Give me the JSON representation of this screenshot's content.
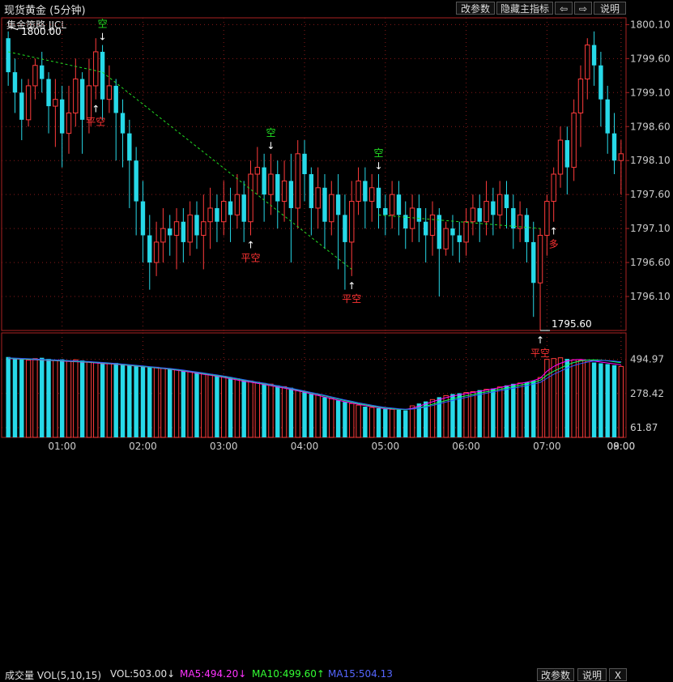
{
  "window": {
    "title": "现货黄金 (5分钟)",
    "strategy_label": "集金策略 JJCL",
    "buttons": [
      "改参数",
      "隐藏主指标",
      "⇦",
      "⇨",
      "说明"
    ]
  },
  "volume_panel": {
    "title": "成交量 VOL(5,10,15)",
    "vol": "VOL:503.00↓",
    "ma5": "MA5:494.20↓",
    "ma10": "MA10:499.60↑",
    "ma15": "MA15:504.13",
    "buttons": [
      "改参数",
      "说明",
      "X"
    ]
  },
  "colors": {
    "up": "#ff3b3b",
    "down": "#27d9e8",
    "up_vol": "#ff3b3b",
    "down_vol": "#27d9e8",
    "grid": "#8a1a1a",
    "axis_text": "#cccccc",
    "ma5": "#ff00ff",
    "ma10": "#00ff66",
    "ma15": "#3355ff",
    "signal_green": "#22dd22",
    "signal_red": "#ff3333",
    "trendline": "#22dd22",
    "ma5_text": "#ff33ff",
    "ma10_text": "#33ff33",
    "ma15_text": "#5566ff"
  },
  "chart_data": [
    {
      "type": "candlestick",
      "price_axis_ticks": [
        "1800.10",
        "1799.60",
        "1799.10",
        "1798.60",
        "1798.10",
        "1797.60",
        "1797.10",
        "1796.60",
        "1796.10"
      ],
      "ylim": [
        1795.6,
        1800.2
      ],
      "time_ticks": [
        "01:00",
        "02:00",
        "03:00",
        "04:00",
        "05:00",
        "06:00",
        "07:00",
        "08:00",
        "09:00"
      ],
      "annotations": [
        {
          "text": "1800.00",
          "price": 1800.0
        },
        {
          "text": "1795.60",
          "price": 1795.6
        }
      ],
      "signals": [
        {
          "label": "空",
          "kind": "short",
          "bar": 14
        },
        {
          "label": "平空",
          "kind": "cover",
          "bar": 13
        },
        {
          "label": "平空",
          "kind": "cover",
          "bar": 36
        },
        {
          "label": "空",
          "kind": "short",
          "bar": 39
        },
        {
          "label": "平空",
          "kind": "cover",
          "bar": 51
        },
        {
          "label": "空",
          "kind": "short",
          "bar": 55
        },
        {
          "label": "平空",
          "kind": "cover",
          "bar": 79
        },
        {
          "label": "多",
          "kind": "long",
          "bar": 81
        }
      ],
      "candles": [
        [
          1799.9,
          1799.4,
          1800.0,
          1799.2
        ],
        [
          1799.4,
          1799.1,
          1799.6,
          1798.8
        ],
        [
          1799.1,
          1798.7,
          1799.3,
          1798.4
        ],
        [
          1798.7,
          1799.2,
          1799.3,
          1798.6
        ],
        [
          1799.2,
          1799.5,
          1799.6,
          1799.0
        ],
        [
          1799.5,
          1799.3,
          1799.7,
          1799.1
        ],
        [
          1799.3,
          1798.9,
          1799.4,
          1798.5
        ],
        [
          1798.9,
          1799.0,
          1799.3,
          1798.3
        ],
        [
          1799.0,
          1798.5,
          1799.2,
          1798.0
        ],
        [
          1798.5,
          1798.8,
          1799.2,
          1798.2
        ],
        [
          1798.8,
          1799.3,
          1799.6,
          1798.6
        ],
        [
          1799.3,
          1798.7,
          1799.4,
          1798.2
        ],
        [
          1798.7,
          1799.2,
          1799.6,
          1798.5
        ],
        [
          1799.2,
          1799.7,
          1799.9,
          1799.0
        ],
        [
          1799.7,
          1799.0,
          1799.8,
          1798.7
        ],
        [
          1799.0,
          1799.2,
          1799.5,
          1798.8
        ],
        [
          1799.2,
          1798.8,
          1799.3,
          1798.1
        ],
        [
          1798.8,
          1798.5,
          1799.0,
          1798.0
        ],
        [
          1798.5,
          1798.1,
          1798.7,
          1797.4
        ],
        [
          1798.1,
          1797.5,
          1798.3,
          1797.0
        ],
        [
          1797.5,
          1797.0,
          1797.8,
          1796.6
        ],
        [
          1797.0,
          1796.6,
          1797.3,
          1796.2
        ],
        [
          1796.6,
          1796.9,
          1797.2,
          1796.4
        ],
        [
          1796.9,
          1797.1,
          1797.4,
          1796.6
        ],
        [
          1797.1,
          1797.0,
          1797.3,
          1796.7
        ],
        [
          1797.0,
          1797.2,
          1797.4,
          1796.5
        ],
        [
          1797.2,
          1796.9,
          1797.4,
          1796.6
        ],
        [
          1796.9,
          1797.3,
          1797.5,
          1796.7
        ],
        [
          1797.3,
          1797.0,
          1797.5,
          1796.8
        ],
        [
          1797.0,
          1797.2,
          1797.6,
          1796.5
        ],
        [
          1797.2,
          1797.4,
          1797.7,
          1796.8
        ],
        [
          1797.4,
          1797.2,
          1797.6,
          1796.9
        ],
        [
          1797.2,
          1797.5,
          1797.8,
          1797.0
        ],
        [
          1797.5,
          1797.3,
          1797.7,
          1796.9
        ],
        [
          1797.3,
          1797.6,
          1797.9,
          1797.1
        ],
        [
          1797.6,
          1797.2,
          1797.8,
          1796.9
        ],
        [
          1797.2,
          1797.9,
          1798.1,
          1797.0
        ],
        [
          1797.9,
          1798.0,
          1798.3,
          1797.6
        ],
        [
          1798.0,
          1797.6,
          1798.2,
          1797.2
        ],
        [
          1797.6,
          1797.9,
          1798.2,
          1797.3
        ],
        [
          1797.9,
          1797.5,
          1798.1,
          1797.1
        ],
        [
          1797.5,
          1797.8,
          1798.1,
          1797.2
        ],
        [
          1797.8,
          1797.4,
          1798.2,
          1796.6
        ],
        [
          1797.4,
          1798.2,
          1798.4,
          1797.1
        ],
        [
          1798.2,
          1797.9,
          1798.4,
          1797.5
        ],
        [
          1797.9,
          1797.4,
          1798.0,
          1797.0
        ],
        [
          1797.4,
          1797.7,
          1798.0,
          1797.1
        ],
        [
          1797.7,
          1797.2,
          1797.9,
          1796.8
        ],
        [
          1797.2,
          1797.6,
          1797.8,
          1797.0
        ],
        [
          1797.6,
          1797.3,
          1797.9,
          1796.5
        ],
        [
          1797.3,
          1796.9,
          1797.6,
          1796.2
        ],
        [
          1796.9,
          1797.5,
          1797.8,
          1796.4
        ],
        [
          1797.5,
          1797.8,
          1798.0,
          1797.3
        ],
        [
          1797.8,
          1797.5,
          1798.0,
          1797.1
        ],
        [
          1797.5,
          1797.7,
          1797.9,
          1797.2
        ],
        [
          1797.7,
          1797.4,
          1797.9,
          1797.1
        ],
        [
          1797.4,
          1797.3,
          1797.6,
          1797.0
        ],
        [
          1797.3,
          1797.6,
          1797.8,
          1797.1
        ],
        [
          1797.6,
          1797.3,
          1797.8,
          1797.0
        ],
        [
          1797.3,
          1797.1,
          1797.5,
          1796.8
        ],
        [
          1797.1,
          1797.4,
          1797.6,
          1796.9
        ],
        [
          1797.4,
          1797.2,
          1797.6,
          1796.9
        ],
        [
          1797.2,
          1797.0,
          1797.4,
          1796.6
        ],
        [
          1797.0,
          1797.3,
          1797.5,
          1796.7
        ],
        [
          1797.3,
          1796.8,
          1797.4,
          1796.1
        ],
        [
          1796.8,
          1797.1,
          1797.2,
          1796.7
        ],
        [
          1797.1,
          1797.0,
          1797.3,
          1796.7
        ],
        [
          1797.0,
          1796.9,
          1797.2,
          1796.6
        ],
        [
          1796.9,
          1797.2,
          1797.4,
          1796.7
        ],
        [
          1797.2,
          1797.4,
          1797.6,
          1797.0
        ],
        [
          1797.4,
          1797.2,
          1797.6,
          1796.9
        ],
        [
          1797.2,
          1797.5,
          1797.8,
          1797.0
        ],
        [
          1797.5,
          1797.3,
          1797.7,
          1797.0
        ],
        [
          1797.3,
          1797.6,
          1797.8,
          1797.1
        ],
        [
          1797.6,
          1797.4,
          1797.8,
          1797.1
        ],
        [
          1797.4,
          1797.1,
          1797.6,
          1796.8
        ],
        [
          1797.1,
          1797.3,
          1797.5,
          1796.9
        ],
        [
          1797.3,
          1796.9,
          1797.4,
          1796.6
        ],
        [
          1796.9,
          1796.3,
          1797.2,
          1795.8
        ],
        [
          1796.3,
          1797.0,
          1797.1,
          1795.6
        ],
        [
          1797.0,
          1797.5,
          1797.6,
          1796.7
        ],
        [
          1797.5,
          1797.9,
          1798.0,
          1797.2
        ],
        [
          1797.9,
          1798.4,
          1798.6,
          1797.7
        ],
        [
          1798.4,
          1798.0,
          1798.6,
          1797.6
        ],
        [
          1798.0,
          1798.8,
          1799.0,
          1797.8
        ],
        [
          1798.8,
          1799.3,
          1799.5,
          1798.3
        ],
        [
          1799.3,
          1799.8,
          1799.9,
          1799.0
        ],
        [
          1799.8,
          1799.5,
          1800.0,
          1799.2
        ],
        [
          1799.5,
          1799.0,
          1799.7,
          1798.6
        ],
        [
          1799.0,
          1798.5,
          1799.2,
          1798.2
        ],
        [
          1798.5,
          1798.1,
          1798.8,
          1797.9
        ],
        [
          1798.1,
          1798.2,
          1798.4,
          1797.6
        ]
      ],
      "trendlines": [
        {
          "from": {
            "bar": 0,
            "price": 1799.7
          },
          "to": {
            "bar": 14,
            "price": 1799.4
          }
        },
        {
          "from": {
            "bar": 14,
            "price": 1799.4
          },
          "to": {
            "bar": 51,
            "price": 1796.5
          }
        },
        {
          "from": {
            "bar": 55,
            "price": 1797.3
          },
          "to": {
            "bar": 79,
            "price": 1797.1
          }
        }
      ]
    },
    {
      "type": "bar",
      "name": "成交量",
      "vol_axis_ticks": [
        "494.97",
        "278.42",
        "61.87"
      ],
      "ylim": [
        0,
        560
      ],
      "volumes": [
        510,
        500,
        495,
        490,
        500,
        505,
        498,
        490,
        495,
        485,
        492,
        488,
        480,
        476,
        470,
        468,
        472,
        466,
        460,
        455,
        450,
        448,
        445,
        440,
        435,
        430,
        425,
        418,
        412,
        405,
        400,
        395,
        388,
        380,
        372,
        365,
        358,
        350,
        345,
        338,
        330,
        322,
        315,
        300,
        290,
        278,
        268,
        255,
        245,
        235,
        225,
        215,
        205,
        195,
        190,
        185,
        180,
        178,
        175,
        172,
        200,
        215,
        228,
        240,
        255,
        265,
        275,
        280,
        285,
        290,
        300,
        305,
        310,
        320,
        330,
        340,
        345,
        350,
        360,
        380,
        495,
        500,
        505,
        498,
        492,
        488,
        480,
        475,
        470,
        465,
        458,
        450
      ],
      "ma5": [
        500,
        498,
        496,
        494,
        492,
        490,
        488,
        486,
        484,
        482,
        480,
        478,
        476,
        472,
        468,
        466,
        464,
        460,
        456,
        452,
        448,
        445,
        440,
        436,
        432,
        426,
        420,
        414,
        408,
        400,
        394,
        388,
        380,
        372,
        364,
        356,
        350,
        343,
        336,
        328,
        320,
        312,
        304,
        295,
        286,
        276,
        266,
        256,
        246,
        236,
        226,
        218,
        210,
        202,
        195,
        188,
        182,
        180,
        178,
        178,
        185,
        198,
        212,
        226,
        240,
        252,
        262,
        270,
        278,
        285,
        292,
        300,
        308,
        316,
        325,
        334,
        342,
        350,
        360,
        375,
        420,
        450,
        470,
        485,
        492,
        494,
        490,
        484,
        478,
        472,
        466,
        460
      ],
      "ma10": [
        502,
        500,
        498,
        496,
        494,
        492,
        490,
        488,
        486,
        484,
        482,
        480,
        478,
        475,
        472,
        469,
        466,
        462,
        458,
        454,
        450,
        446,
        442,
        438,
        434,
        429,
        424,
        418,
        412,
        405,
        398,
        392,
        385,
        377,
        370,
        362,
        355,
        348,
        340,
        333,
        325,
        317,
        309,
        300,
        291,
        282,
        273,
        263,
        253,
        243,
        233,
        224,
        215,
        207,
        199,
        192,
        186,
        182,
        179,
        177,
        180,
        188,
        198,
        210,
        222,
        234,
        245,
        255,
        264,
        272,
        281,
        289,
        297,
        305,
        313,
        322,
        331,
        340,
        350,
        362,
        395,
        420,
        440,
        460,
        475,
        485,
        490,
        492,
        490,
        486,
        480,
        474
      ],
      "ma15": [
        505,
        503,
        501,
        499,
        497,
        495,
        493,
        491,
        489,
        487,
        485,
        483,
        481,
        478,
        475,
        472,
        469,
        465,
        461,
        457,
        453,
        449,
        445,
        441,
        437,
        432,
        427,
        421,
        415,
        409,
        402,
        396,
        389,
        382,
        374,
        366,
        358,
        351,
        344,
        336,
        328,
        320,
        312,
        303,
        294,
        285,
        276,
        267,
        257,
        247,
        238,
        229,
        220,
        212,
        204,
        197,
        190,
        186,
        182,
        179,
        180,
        185,
        193,
        202,
        213,
        224,
        235,
        245,
        254,
        263,
        272,
        280,
        288,
        296,
        304,
        312,
        320,
        329,
        338,
        349,
        375,
        400,
        420,
        440,
        455,
        468,
        478,
        485,
        488,
        487,
        484,
        479
      ]
    }
  ]
}
